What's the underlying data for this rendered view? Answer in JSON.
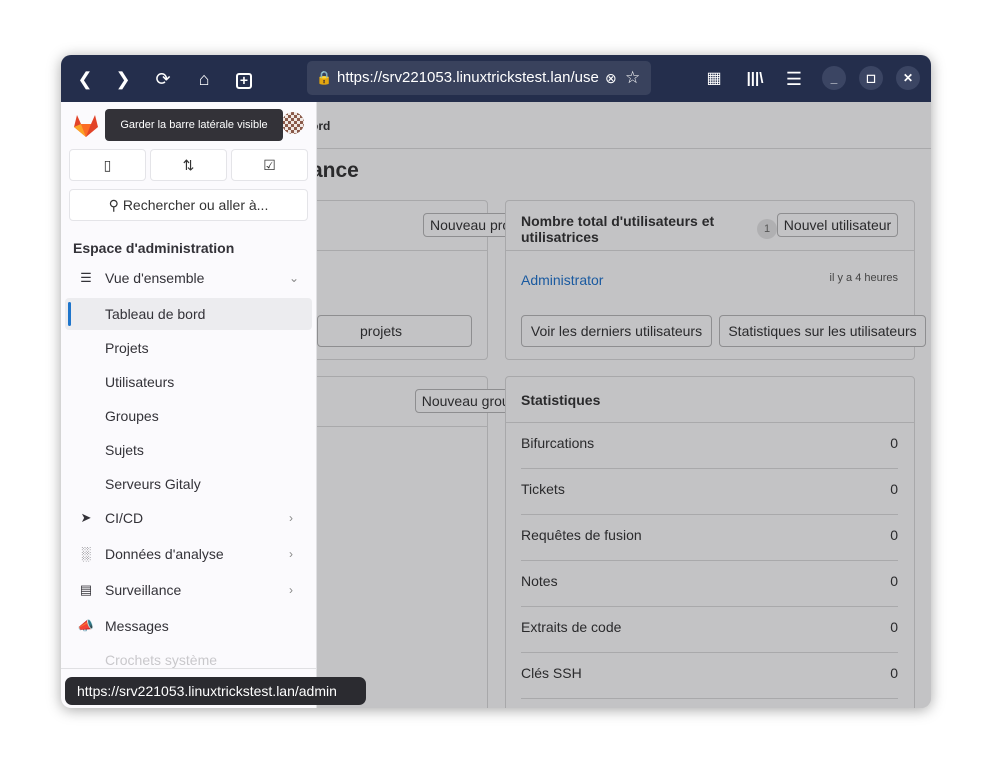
{
  "browser": {
    "url": "https://srv221053.linuxtrickstest.lan/use",
    "status_url": "https://srv221053.linuxtrickstest.lan/admin",
    "icons": [
      "back-icon",
      "forward-icon",
      "reload-icon",
      "home-icon",
      "new-tab-icon",
      "lock-icon",
      "clear-icon",
      "star-icon",
      "extensions-icon",
      "library-icon",
      "menu-icon",
      "minimize-icon",
      "maximize-icon",
      "close-icon"
    ]
  },
  "sidebar": {
    "tooltip": "Garder la barre latérale visible",
    "search_placeholder": "Rechercher ou aller à...",
    "section_title": "Espace d'administration",
    "items": [
      {
        "label": "Vue d'ensemble",
        "icon": "overview-icon"
      },
      {
        "label": "Tableau de bord"
      },
      {
        "label": "Projets"
      },
      {
        "label": "Utilisateurs"
      },
      {
        "label": "Groupes"
      },
      {
        "label": "Sujets"
      },
      {
        "label": "Serveurs Gitaly"
      },
      {
        "label": "CI/CD",
        "icon": "rocket-icon"
      },
      {
        "label": "Données d'analyse",
        "icon": "chart-icon"
      },
      {
        "label": "Surveillance",
        "icon": "monitor-icon"
      },
      {
        "label": "Messages",
        "icon": "megaphone-icon"
      },
      {
        "label": "Crochets système"
      }
    ],
    "active": "Tableau de bord",
    "accent": "#1f75cb"
  },
  "main": {
    "breadcrumb": "ord",
    "title": "ance",
    "projects_card": {
      "new_button": "Nouveau projet",
      "all_button": "projets"
    },
    "groups_card": {
      "new_button": "Nouveau groupe"
    },
    "users_card": {
      "title": "Nombre total d'utilisateurs et utilisatrices",
      "count": "1",
      "new_button": "Nouvel utilisateur",
      "user": "Administrator",
      "time": "il y a 4 heures",
      "latest_button": "Voir les derniers utilisateurs",
      "stats_button": "Statistiques sur les utilisateurs"
    },
    "stats_card": {
      "title": "Statistiques",
      "rows": [
        {
          "label": "Bifurcations",
          "value": "0"
        },
        {
          "label": "Tickets",
          "value": "0"
        },
        {
          "label": "Requêtes de fusion",
          "value": "0"
        },
        {
          "label": "Notes",
          "value": "0"
        },
        {
          "label": "Extraits de code",
          "value": "0"
        },
        {
          "label": "Clés SSH",
          "value": "0"
        }
      ]
    }
  }
}
